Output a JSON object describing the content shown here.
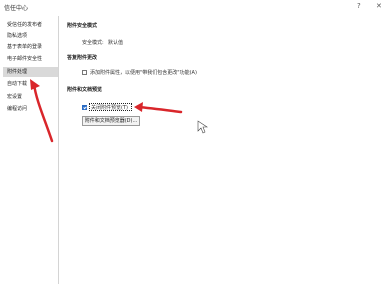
{
  "window": {
    "title": "信任中心",
    "help_label": "?",
    "close_label": "✕"
  },
  "sidebar": {
    "items": [
      {
        "label": "受信任的发布者"
      },
      {
        "label": "隐私选项"
      },
      {
        "label": "基于表单的登录"
      },
      {
        "label": "电子邮件安全性"
      },
      {
        "label": "附件处理"
      },
      {
        "label": "自动下载"
      },
      {
        "label": "宏设置"
      },
      {
        "label": "编程访问"
      }
    ],
    "selected_index": 4
  },
  "main": {
    "attachment_security": {
      "heading": "附件安全模式",
      "mode_label": "安全模式:",
      "mode_value": "默认值"
    },
    "reply_with_changes": {
      "heading": "答复附件更改",
      "checkbox_label": "添加附件属性，以便用\"带我们包含更改\"功能(A)",
      "checked": false
    },
    "preview": {
      "heading": "附件和文档预览",
      "checkbox_label": "关闭附件预览(T)",
      "checked": true,
      "button_label": "附件和文档预览器(D)..."
    }
  },
  "colors": {
    "arrow": "#d9262b",
    "checkbox_checked": "#2b6cc4",
    "sidebar_selected": "#d9d9d9"
  }
}
